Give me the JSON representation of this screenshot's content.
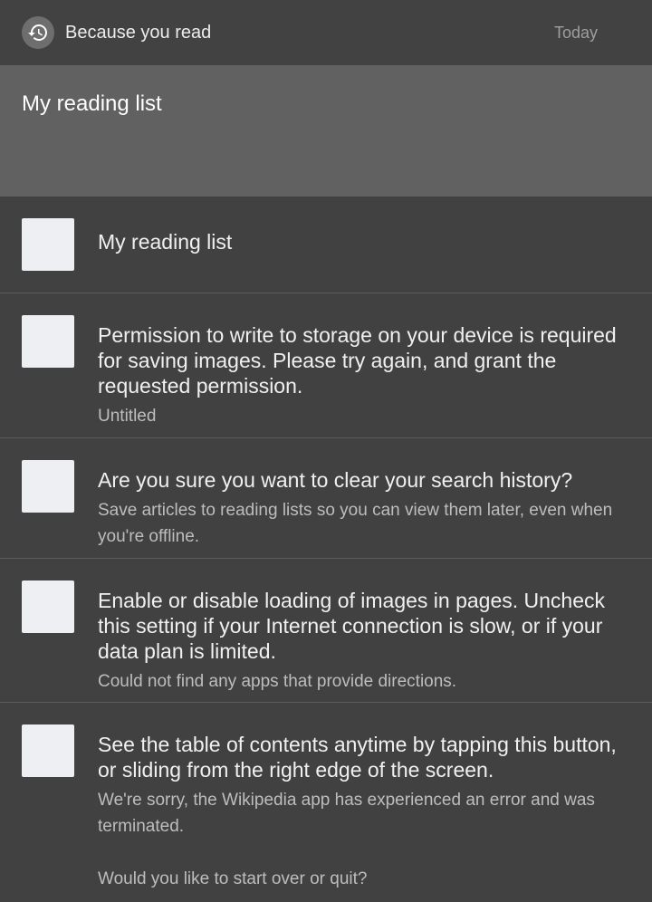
{
  "header": {
    "title": "Because you read",
    "date": "Today",
    "icon": "history-icon"
  },
  "banner": {
    "title": "My reading list"
  },
  "items": [
    {
      "title": "My reading list",
      "subtitle": ""
    },
    {
      "title": "Permission to write to storage on your device is required for saving images. Please try again, and grant the requested permission.",
      "subtitle": "Untitled"
    },
    {
      "title": "Are you sure you want to clear your search history?",
      "subtitle": "Save articles to reading lists so you can view them later, even when you're offline."
    },
    {
      "title": "Enable or disable loading of images in pages. Uncheck this setting if your Internet connection is slow, or if your data plan is limited.",
      "subtitle": "Could not find any apps that provide directions."
    },
    {
      "title": "See the table of contents anytime by tapping this button, or sliding from the right edge of the screen.",
      "subtitle": "We're sorry, the Wikipedia app has experienced an error and was terminated.\n\nWould you like to start over or quit?"
    }
  ],
  "colors": {
    "background": "#414141",
    "banner": "#616161",
    "thumbnail": "#eeeff3"
  }
}
